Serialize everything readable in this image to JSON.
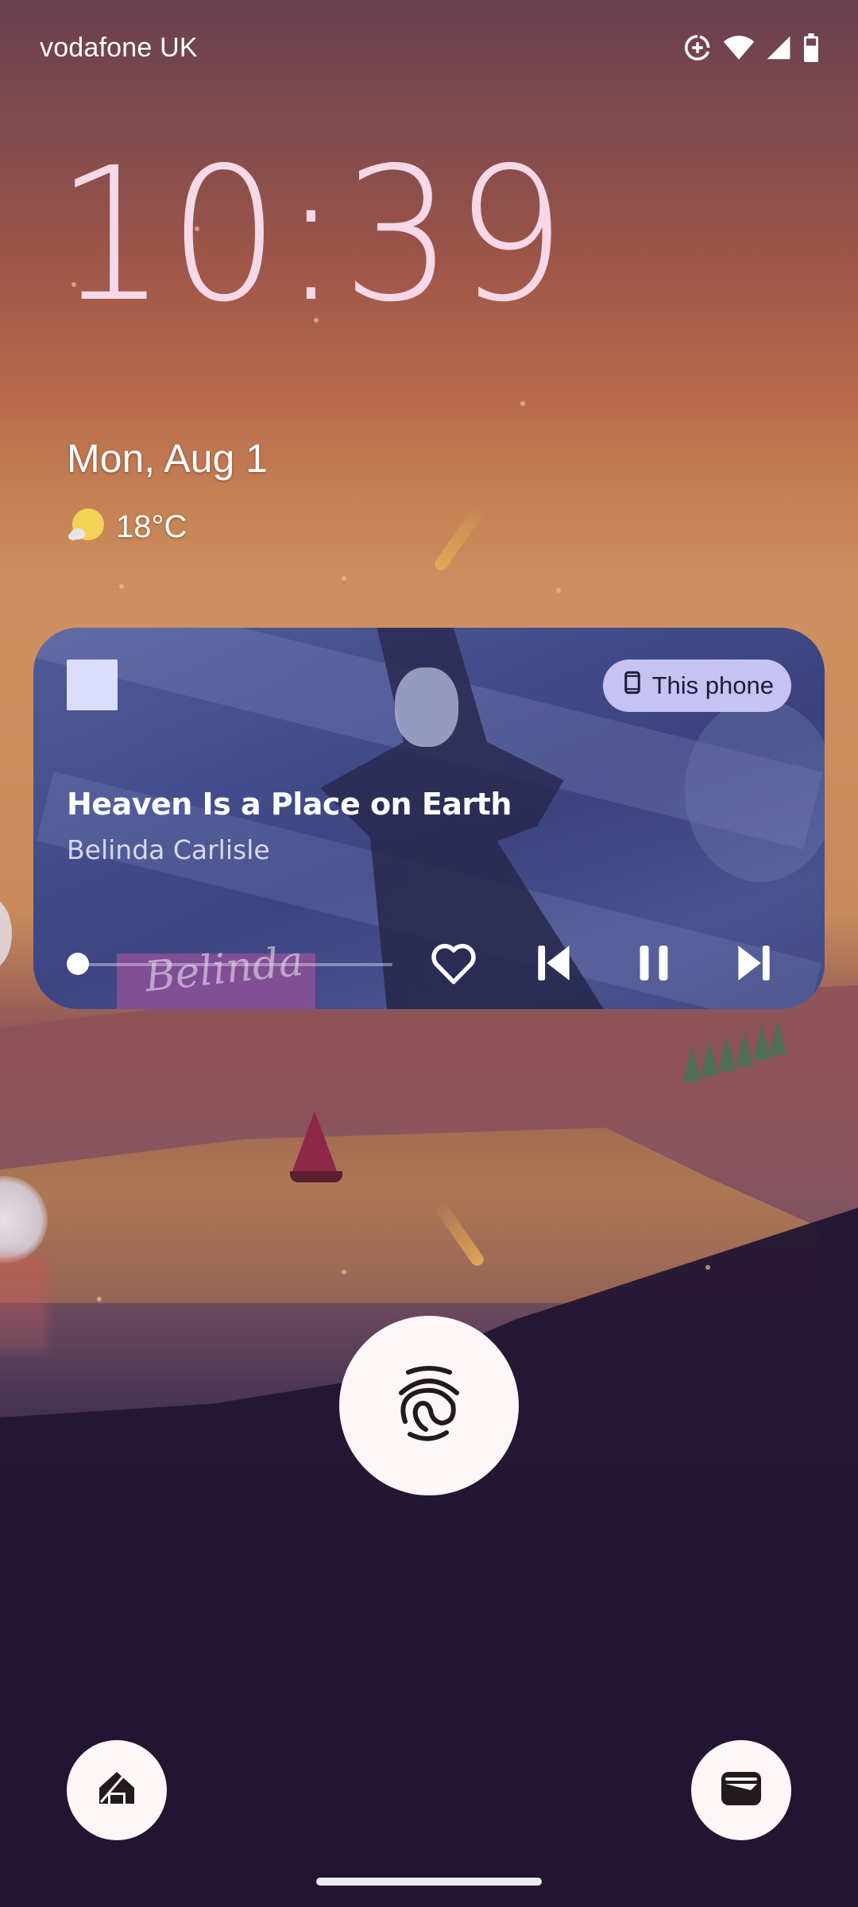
{
  "status_bar": {
    "carrier": "vodafone UK",
    "icons": [
      "data-saver-icon",
      "wifi-icon",
      "cell-signal-icon",
      "battery-icon"
    ]
  },
  "lockscreen": {
    "time": "10:39",
    "date": "Mon, Aug 1",
    "weather": {
      "icon": "partly-sunny-icon",
      "temperature": "18°C"
    }
  },
  "media_player": {
    "app_icon": "media-app-icon",
    "output_device": {
      "icon": "phone-icon",
      "label": "This phone"
    },
    "track_title": "Heaven Is a Place on Earth",
    "artist": "Belinda Carlisle",
    "album_art_text": "Belinda",
    "progress_percent": 2,
    "controls": [
      "favorite-icon",
      "skip-previous-icon",
      "pause-icon",
      "skip-next-icon"
    ],
    "colors": {
      "chip_bg": "#c6c2f2",
      "chip_text": "#1e1b38"
    }
  },
  "unlock": {
    "icon": "fingerprint-icon"
  },
  "shortcuts": {
    "left": "home-controls-icon",
    "right": "wallet-icon"
  }
}
